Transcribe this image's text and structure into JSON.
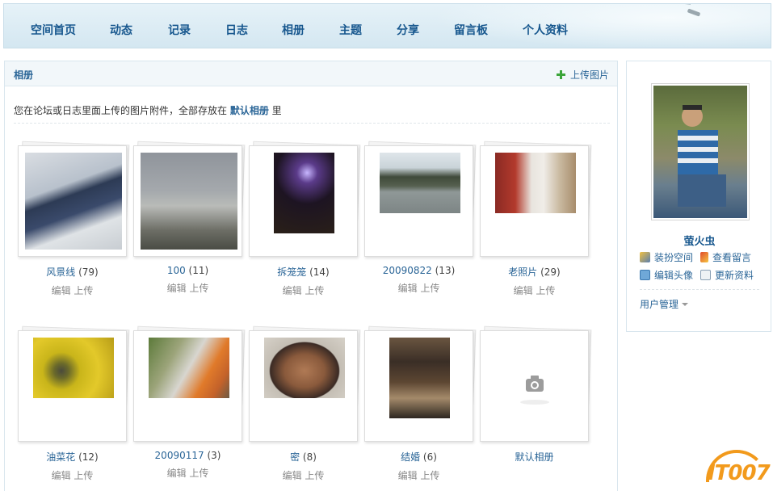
{
  "nav": {
    "items": [
      "空间首页",
      "动态",
      "记录",
      "日志",
      "相册",
      "主题",
      "分享",
      "留言板",
      "个人资料"
    ]
  },
  "album_panel": {
    "title": "相册",
    "upload_label": "上传图片",
    "intro_prefix": "您在论坛或日志里面上传的图片附件，全部存放在 ",
    "intro_link": "默认相册",
    "intro_suffix": " 里",
    "edit_label": "编辑",
    "upload_action_label": "上传",
    "albums": [
      {
        "name": "风景线",
        "count": "(79)"
      },
      {
        "name": "100",
        "count": "(11)"
      },
      {
        "name": "拆笼笼",
        "count": "(14)"
      },
      {
        "name": "20090822",
        "count": "(13)"
      },
      {
        "name": "老照片",
        "count": "(29)"
      },
      {
        "name": "油菜花",
        "count": "(12)"
      },
      {
        "name": "20090117",
        "count": "(3)"
      },
      {
        "name": "密",
        "count": "(8)"
      },
      {
        "name": "结婚",
        "count": "(6)"
      },
      {
        "name": "默认相册",
        "count": ""
      }
    ]
  },
  "sidebar": {
    "username": "萤火虫",
    "links": [
      "装扮空间",
      "查看留言",
      "编辑头像",
      "更新资料"
    ],
    "user_manage": "用户管理"
  },
  "watermark": {
    "text": "IT007"
  },
  "colors": {
    "link": "#2a6597",
    "nav_text": "#17578e",
    "watermark": "#f29a1c",
    "plus_icon": "#3ca53a"
  }
}
